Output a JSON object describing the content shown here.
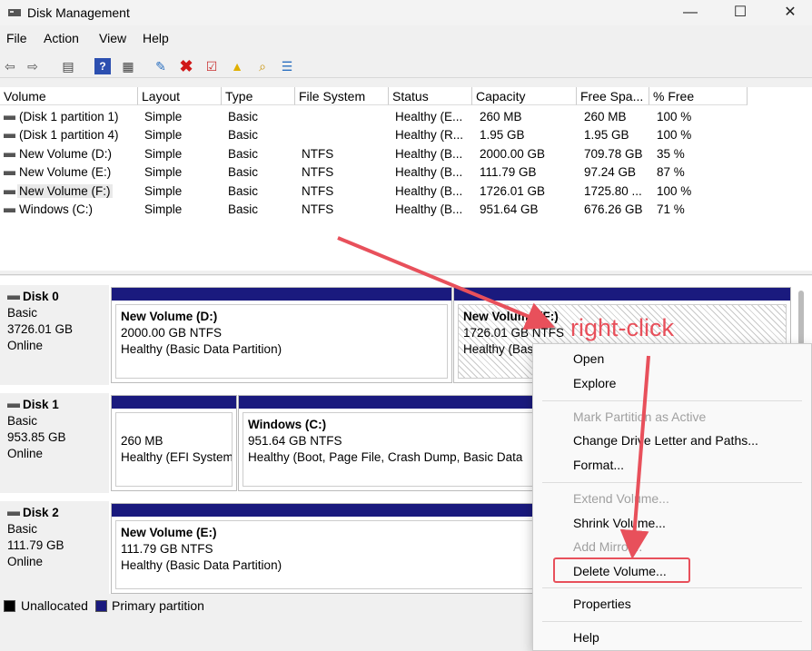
{
  "window": {
    "title": "Disk Management",
    "minimize": "—",
    "maximize": "☐",
    "close": "✕"
  },
  "menu": [
    "File",
    "Action",
    "View",
    "Help"
  ],
  "toolbar_icons": [
    "back-arrow-icon",
    "forward-arrow-icon",
    "disk-list-icon",
    "help-icon",
    "properties-icon",
    "connect-icon",
    "delete-x-icon",
    "check-icon",
    "folder-up-icon",
    "search-folder-icon",
    "settings-list-icon"
  ],
  "columns": [
    "Volume",
    "Layout",
    "Type",
    "File System",
    "Status",
    "Capacity",
    "Free Spa...",
    "% Free"
  ],
  "volumes": [
    [
      "(Disk 1 partition 1)",
      "Simple",
      "Basic",
      "",
      "Healthy (E...",
      "260 MB",
      "260 MB",
      "100 %"
    ],
    [
      "(Disk 1 partition 4)",
      "Simple",
      "Basic",
      "",
      "Healthy (R...",
      "1.95 GB",
      "1.95 GB",
      "100 %"
    ],
    [
      "New Volume (D:)",
      "Simple",
      "Basic",
      "NTFS",
      "Healthy (B...",
      "2000.00 GB",
      "709.78 GB",
      "35 %"
    ],
    [
      "New Volume (E:)",
      "Simple",
      "Basic",
      "NTFS",
      "Healthy (B...",
      "111.79 GB",
      "97.24 GB",
      "87 %"
    ],
    [
      "New Volume (F:)",
      "Simple",
      "Basic",
      "NTFS",
      "Healthy (B...",
      "1726.01 GB",
      "1725.80 ...",
      "100 %"
    ],
    [
      "Windows (C:)",
      "Simple",
      "Basic",
      "NTFS",
      "Healthy (B...",
      "951.64 GB",
      "676.26 GB",
      "71 %"
    ]
  ],
  "disks": [
    {
      "name": "Disk 0",
      "type": "Basic",
      "size": "3726.01 GB",
      "state": "Online",
      "partitions": [
        {
          "name": "New Volume  (D:)",
          "size": "2000.00 GB NTFS",
          "status": "Healthy (Basic Data Partition)"
        },
        {
          "name": "New Volume  (F:)",
          "size": "1726.01 GB NTFS",
          "status": "Healthy (Bas"
        }
      ]
    },
    {
      "name": "Disk 1",
      "type": "Basic",
      "size": "953.85 GB",
      "state": "Online",
      "partitions": [
        {
          "name": "",
          "size": "260 MB",
          "status": "Healthy (EFI System"
        },
        {
          "name": "Windows  (C:)",
          "size": "951.64 GB NTFS",
          "status": "Healthy (Boot, Page File, Crash Dump, Basic Data"
        }
      ]
    },
    {
      "name": "Disk 2",
      "type": "Basic",
      "size": "111.79 GB",
      "state": "Online",
      "partitions": [
        {
          "name": "New Volume  (E:)",
          "size": "111.79 GB NTFS",
          "status": "Healthy (Basic Data Partition)"
        }
      ]
    }
  ],
  "legend": {
    "unallocated": "Unallocated",
    "primary": "Primary partition"
  },
  "context_menu": {
    "open": "Open",
    "explore": "Explore",
    "mark_active": "Mark Partition as Active",
    "change_letter": "Change Drive Letter and Paths...",
    "format": "Format...",
    "extend": "Extend Volume...",
    "shrink": "Shrink Volume...",
    "add_mirror": "Add Mirror...",
    "delete": "Delete Volume...",
    "properties": "Properties",
    "help": "Help"
  },
  "annotation": {
    "text": "right-click",
    "color": "#e8505b"
  },
  "colors": {
    "primary_partition": "#1a1a7e",
    "unallocated": "#000000"
  }
}
